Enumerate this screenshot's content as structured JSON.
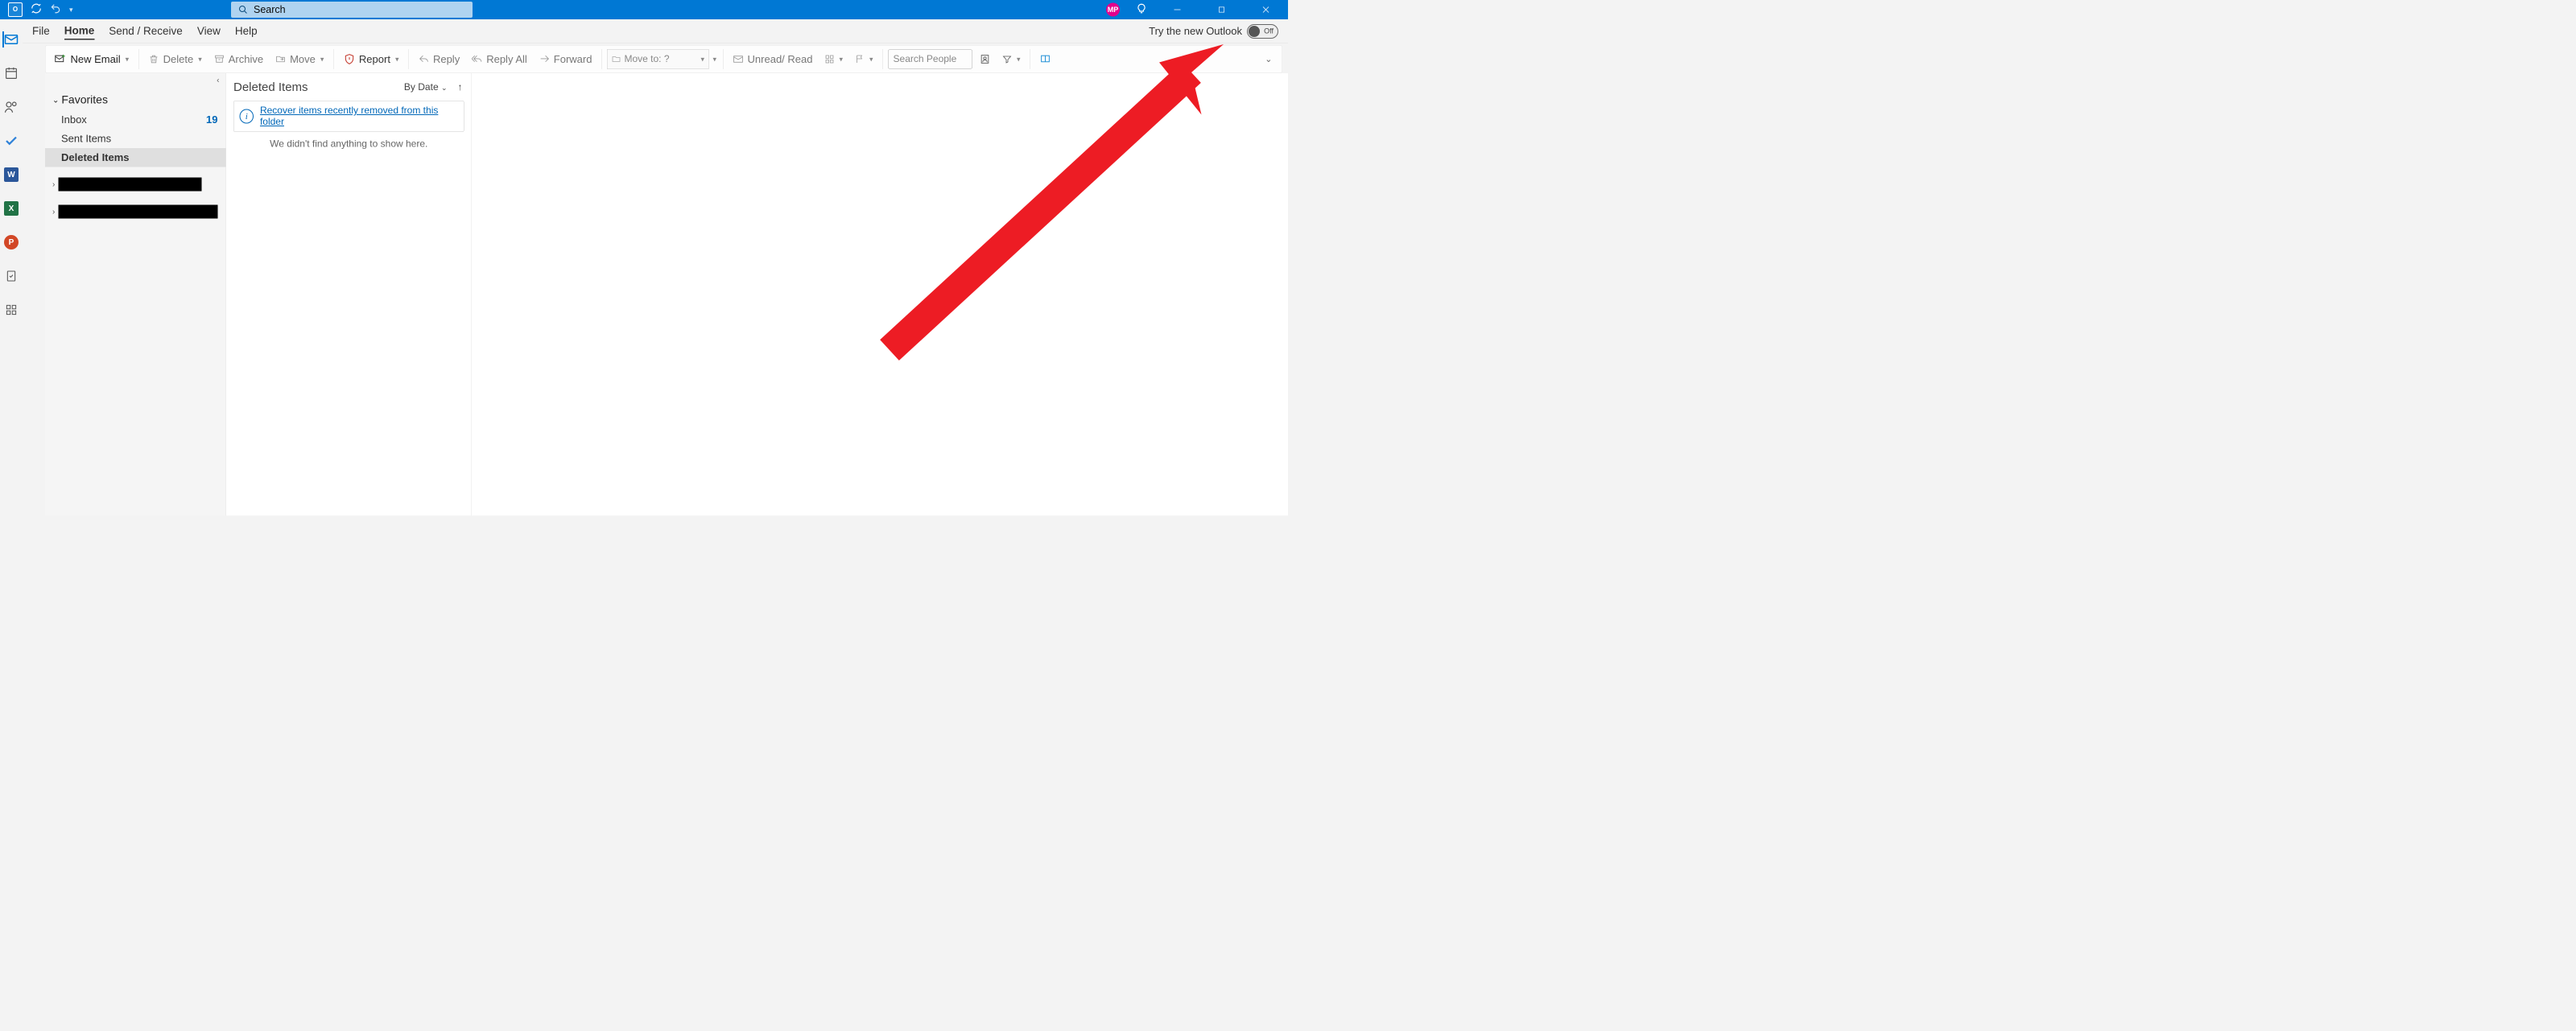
{
  "titlebar": {
    "search_placeholder": "Search",
    "user_initials": "MP"
  },
  "tabs": {
    "file": "File",
    "home": "Home",
    "sendreceive": "Send / Receive",
    "view": "View",
    "help": "Help",
    "try_new": "Try the new Outlook",
    "toggle_state": "Off"
  },
  "ribbon": {
    "new_email": "New Email",
    "delete": "Delete",
    "archive": "Archive",
    "move": "Move",
    "report": "Report",
    "reply": "Reply",
    "reply_all": "Reply All",
    "forward": "Forward",
    "move_to": "Move to: ?",
    "unread_read": "Unread/ Read",
    "search_people": "Search People"
  },
  "folders": {
    "favorites": "Favorites",
    "inbox": "Inbox",
    "inbox_count": "19",
    "sent": "Sent Items",
    "deleted": "Deleted Items"
  },
  "msglist": {
    "title": "Deleted Items",
    "sort": "By Date",
    "recover": "Recover items recently removed from this folder",
    "empty": "We didn't find anything to show here."
  }
}
